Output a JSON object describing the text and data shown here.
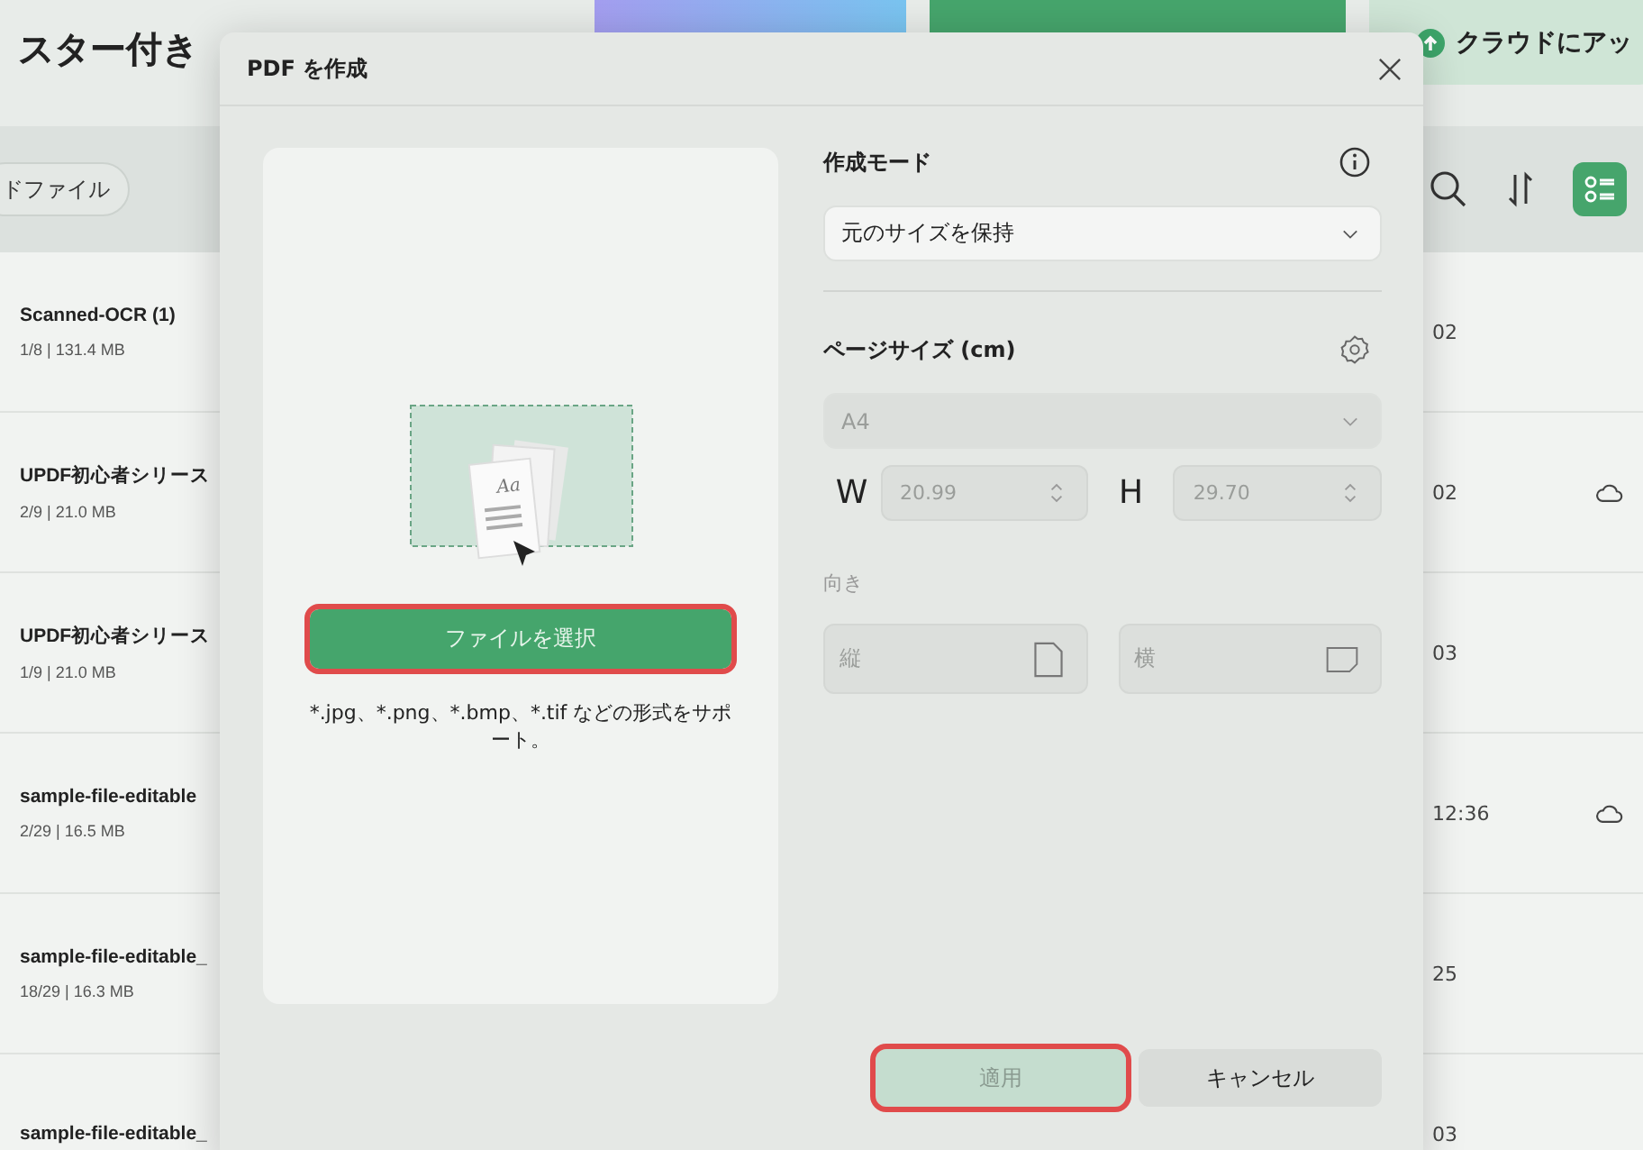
{
  "header": {
    "title": "スター付き",
    "action_buttons": [
      {
        "kind": "gradient"
      },
      {
        "kind": "green"
      },
      {
        "kind": "light",
        "label": "クラウドにアッ"
      }
    ]
  },
  "toolbar": {
    "filter_chip": "ドファイル",
    "list_view_selected": true
  },
  "files": [
    {
      "name": "Scanned-OCR (1)",
      "meta": "1/8 | 131.4 MB",
      "date": "02",
      "cloud": false
    },
    {
      "name": "UPDF初心者シリース",
      "meta": "2/9 | 21.0 MB",
      "date": "02",
      "cloud": true
    },
    {
      "name": "UPDF初心者シリース",
      "meta": "1/9 | 21.0 MB",
      "date": "03",
      "cloud": false
    },
    {
      "name": "sample-file-editable",
      "meta": "2/29 | 16.5 MB",
      "date": "12:36",
      "cloud": true
    },
    {
      "name": "sample-file-editable_",
      "meta": "18/29 | 16.3 MB",
      "date": "25",
      "cloud": false
    },
    {
      "name": "sample-file-editable_",
      "date": "03",
      "cloud": false
    }
  ],
  "dialog": {
    "title": "PDF を作成",
    "illustration_text": "Aa",
    "select_button": {
      "label": "ファイルを選択",
      "highlighted": true
    },
    "support_text": "*.jpg、*.png、*.bmp、*.tif などの形式をサポート。",
    "mode_label": "作成モード",
    "mode_value": "元のサイズを保持",
    "page_size_label": "ページサイズ (cm)",
    "page_size_value": "A4",
    "page_size_disabled": true,
    "w_label": "W",
    "w_value": "20.99",
    "h_label": "H",
    "h_value": "29.70",
    "orientation_label": "向き",
    "orientations": [
      {
        "kind": "portrait",
        "label": "縦",
        "disabled": true
      },
      {
        "kind": "landscape",
        "label": "横",
        "disabled": true
      }
    ],
    "apply_button": {
      "label": "適用",
      "disabled": true,
      "highlighted": true
    },
    "cancel_button": {
      "label": "キャンセル"
    }
  }
}
